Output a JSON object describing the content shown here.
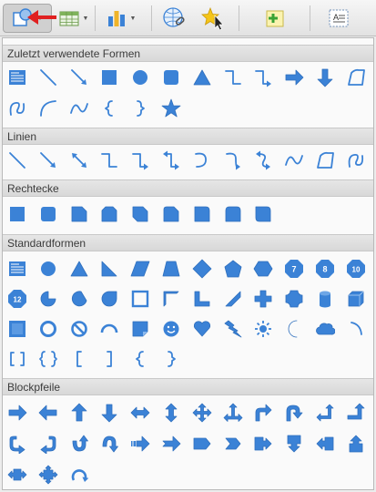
{
  "sections": {
    "recent": "Zuletzt verwendete Formen",
    "lines": "Linien",
    "rectangles": "Rechtecke",
    "standard": "Standardformen",
    "block_arrows": "Blockpfeile"
  },
  "shape_labels": {
    "oct_7": "7",
    "oct_8": "8",
    "oct_10": "10",
    "oct_12": "12"
  },
  "colors": {
    "shape_fill": "#3b82d6",
    "shape_stroke": "#2f6fbd",
    "arrow_red": "#e02020"
  },
  "toolbar_icons": [
    "shapes-icon",
    "table-icon",
    "chart-icon",
    "link-icon",
    "star-cursor-icon",
    "add-note-icon",
    "text-box-icon"
  ]
}
